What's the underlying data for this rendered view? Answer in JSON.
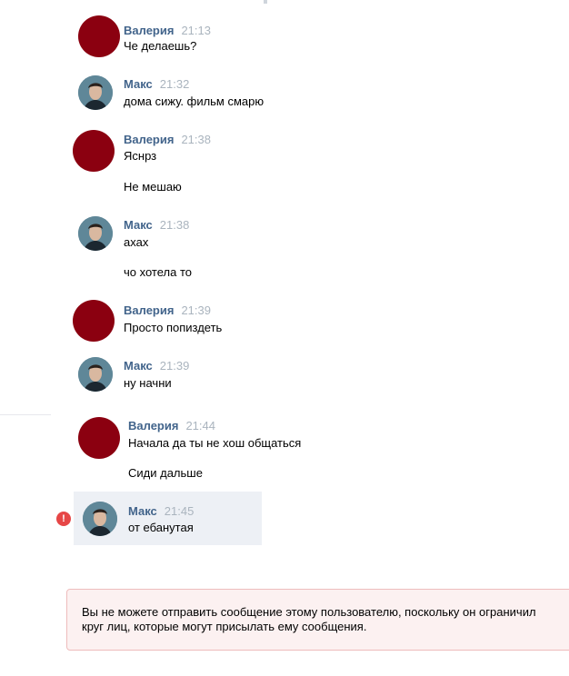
{
  "messages": [
    {
      "author": "Валерия",
      "time": "21:13",
      "lines": [
        "Че делаешь?"
      ],
      "avatar": "red-circle"
    },
    {
      "author": "Макс",
      "time": "21:32",
      "lines": [
        "дома сижу. фильм смарю"
      ],
      "avatar": "photo"
    },
    {
      "author": "Валерия",
      "time": "21:38",
      "lines": [
        "Яснрз",
        "Не мешаю"
      ],
      "avatar": "red-circle"
    },
    {
      "author": "Макс",
      "time": "21:38",
      "lines": [
        "ахах",
        "чо хотела то"
      ],
      "avatar": "photo"
    },
    {
      "author": "Валерия",
      "time": "21:39",
      "lines": [
        "Просто попиздеть"
      ],
      "avatar": "red-circle"
    },
    {
      "author": "Макс",
      "time": "21:39",
      "lines": [
        "ну начни"
      ],
      "avatar": "photo"
    },
    {
      "author": "Валерия",
      "time": "21:44",
      "lines": [
        "Начала да ты не хош общаться",
        "Сиди дальше"
      ],
      "avatar": "red-circle"
    },
    {
      "author": "Макс",
      "time": "21:45",
      "lines": [
        "от ебанутая"
      ],
      "avatar": "photo"
    }
  ],
  "error_badge": "!",
  "notice": "Вы не можете отправить сообщение этому пользователю, поскольку он ограничил круг лиц, которые могут присылать ему сообщения.",
  "colors": {
    "author": "#42648b",
    "time": "#aab4be",
    "avatar_red": "#8b0010",
    "error": "#e64646",
    "notice_bg": "#fcf1f1",
    "highlight": "#edf0f5"
  }
}
